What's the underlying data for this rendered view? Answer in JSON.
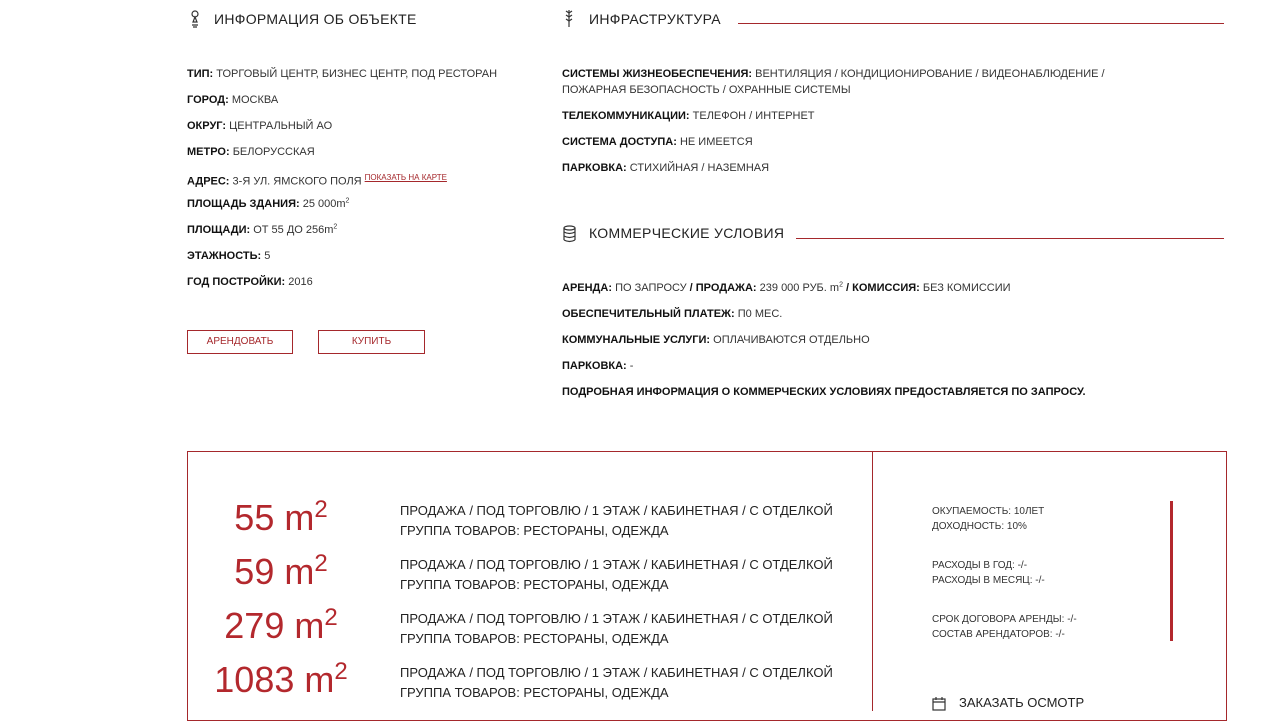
{
  "info": {
    "title": "ИНФОРМАЦИЯ ОБ ОБЪЕКТЕ",
    "fields": [
      {
        "label": "ТИП:",
        "value": "ТОРГОВЫЙ ЦЕНТР, БИЗНЕС ЦЕНТР, ПОД РЕСТОРАН"
      },
      {
        "label": "ГОРОД:",
        "value": "МОСКВА"
      },
      {
        "label": "ОКРУГ:",
        "value": "ЦЕНТРАЛЬНЫЙ АО"
      },
      {
        "label": "МЕТРО:",
        "value": "БЕЛОРУССКАЯ"
      },
      {
        "label": "АДРЕС:",
        "value": "3-Я УЛ. ЯМСКОГО ПОЛЯ"
      },
      {
        "label": "ПЛОЩАДЬ ЗДАНИЯ:",
        "value": "25 000m",
        "sup": "2"
      },
      {
        "label": "ПЛОЩАДИ:",
        "value": "ОТ 55 ДО 256m",
        "sup": "2"
      },
      {
        "label": "ЭТАЖНОСТЬ:",
        "value": "5"
      },
      {
        "label": "ГОД ПОСТРОЙКИ:",
        "value": "2016"
      }
    ],
    "map_link": "ПОКАЗАТЬ НА КАРТЕ",
    "buttons": {
      "rent": "АРЕНДОВАТЬ",
      "buy": "КУПИТЬ"
    }
  },
  "infra": {
    "title": "ИНФРАСТРУКТУРА",
    "fields": [
      {
        "label": "СИСТЕМЫ ЖИЗНЕОБЕСПЕЧЕНИЯ:",
        "value": "ВЕНТИЛЯЦИЯ / КОНДИЦИОНИРОВАНИЕ / ВИДЕОНАБЛЮДЕНИЕ /",
        "value2": "ПОЖАРНАЯ БЕЗОПАСНОСТЬ / ОХРАННЫЕ СИСТЕМЫ"
      },
      {
        "label": "ТЕЛЕКОММУНИКАЦИИ:",
        "value": "ТЕЛЕФОН / ИНТЕРНЕТ"
      },
      {
        "label": "СИСТЕМА ДОСТУПА:",
        "value": "НЕ ИМЕЕТСЯ"
      },
      {
        "label": "ПАРКОВКА:",
        "value": "СТИХИЙНАЯ / НАЗЕМНАЯ"
      }
    ]
  },
  "commercial": {
    "title": "КОММЕРЧЕСКИЕ УСЛОВИЯ",
    "rent_label": "АРЕНДА:",
    "rent_value": "ПО ЗАПРОСУ",
    "sale_label": "/ ПРОДАЖА:",
    "sale_value": "239 000 РУБ. m",
    "sale_sup": "2",
    "commission_label": "/ КОМИССИЯ:",
    "commission_value": "БЕЗ КОМИССИИ",
    "fields": [
      {
        "label": "ОБЕСПЕЧИТЕЛЬНЫЙ ПЛАТЕЖ:",
        "value": "П0 МЕС."
      },
      {
        "label": "КОММУНАЛЬНЫЕ УСЛУГИ:",
        "value": "ОПЛАЧИВАЮТСЯ ОТДЕЛЬНО"
      },
      {
        "label": "ПАРКОВКА:",
        "value": "-"
      }
    ],
    "note": "ПОДРОБНАЯ ИНФОРМАЦИЯ О КОММЕРЧЕСКИХ УСЛОВИЯХ ПРЕДОСТАВЛЯЕТСЯ ПО ЗАПРОСУ."
  },
  "offers": [
    {
      "area": "55 m",
      "sup": "2",
      "line1": "ПРОДАЖА / ПОД ТОРГОВЛЮ / 1 ЭТАЖ / КАБИНЕТНАЯ / С ОТДЕЛКОЙ",
      "line2": "ГРУППА ТОВАРОВ: РЕСТОРАНЫ, ОДЕЖДА"
    },
    {
      "area": "59 m",
      "sup": "2",
      "line1": "ПРОДАЖА / ПОД ТОРГОВЛЮ / 1 ЭТАЖ / КАБИНЕТНАЯ / С ОТДЕЛКОЙ",
      "line2": "ГРУППА ТОВАРОВ: РЕСТОРАНЫ, ОДЕЖДА"
    },
    {
      "area": "279 m",
      "sup": "2",
      "line1": "ПРОДАЖА / ПОД ТОРГОВЛЮ / 1 ЭТАЖ / КАБИНЕТНАЯ / С ОТДЕЛКОЙ",
      "line2": "ГРУППА ТОВАРОВ: РЕСТОРАНЫ, ОДЕЖДА"
    },
    {
      "area": "1083 m",
      "sup": "2",
      "line1": "ПРОДАЖА / ПОД ТОРГОВЛЮ / 1 ЭТАЖ / КАБИНЕТНАЯ / С ОТДЕЛКОЙ",
      "line2": "ГРУППА ТОВАРОВ: РЕСТОРАНЫ, ОДЕЖДА"
    }
  ],
  "stats": {
    "payback": "ОКУПАЕМОСТЬ: 10ЛЕТ",
    "yield": "ДОХОДНОСТЬ: 10%",
    "expenses_year": "РАСХОДЫ В ГОД: -/-",
    "expenses_month": "РАСХОДЫ В МЕСЯЦ: -/-",
    "lease_term": "СРОК ДОГОВОРА АРЕНДЫ: -/-",
    "tenants": "СОСТАВ АРЕНДАТОРОВ: -/-",
    "order_view": "ЗАКАЗАТЬ ОСМОТР"
  },
  "colors": {
    "accent": "#a5282c",
    "area_red": "#b3282d"
  },
  "icons": {
    "info": "pin-icon",
    "infra": "wheat-icon",
    "commercial": "coins-icon",
    "order": "calendar-icon"
  }
}
